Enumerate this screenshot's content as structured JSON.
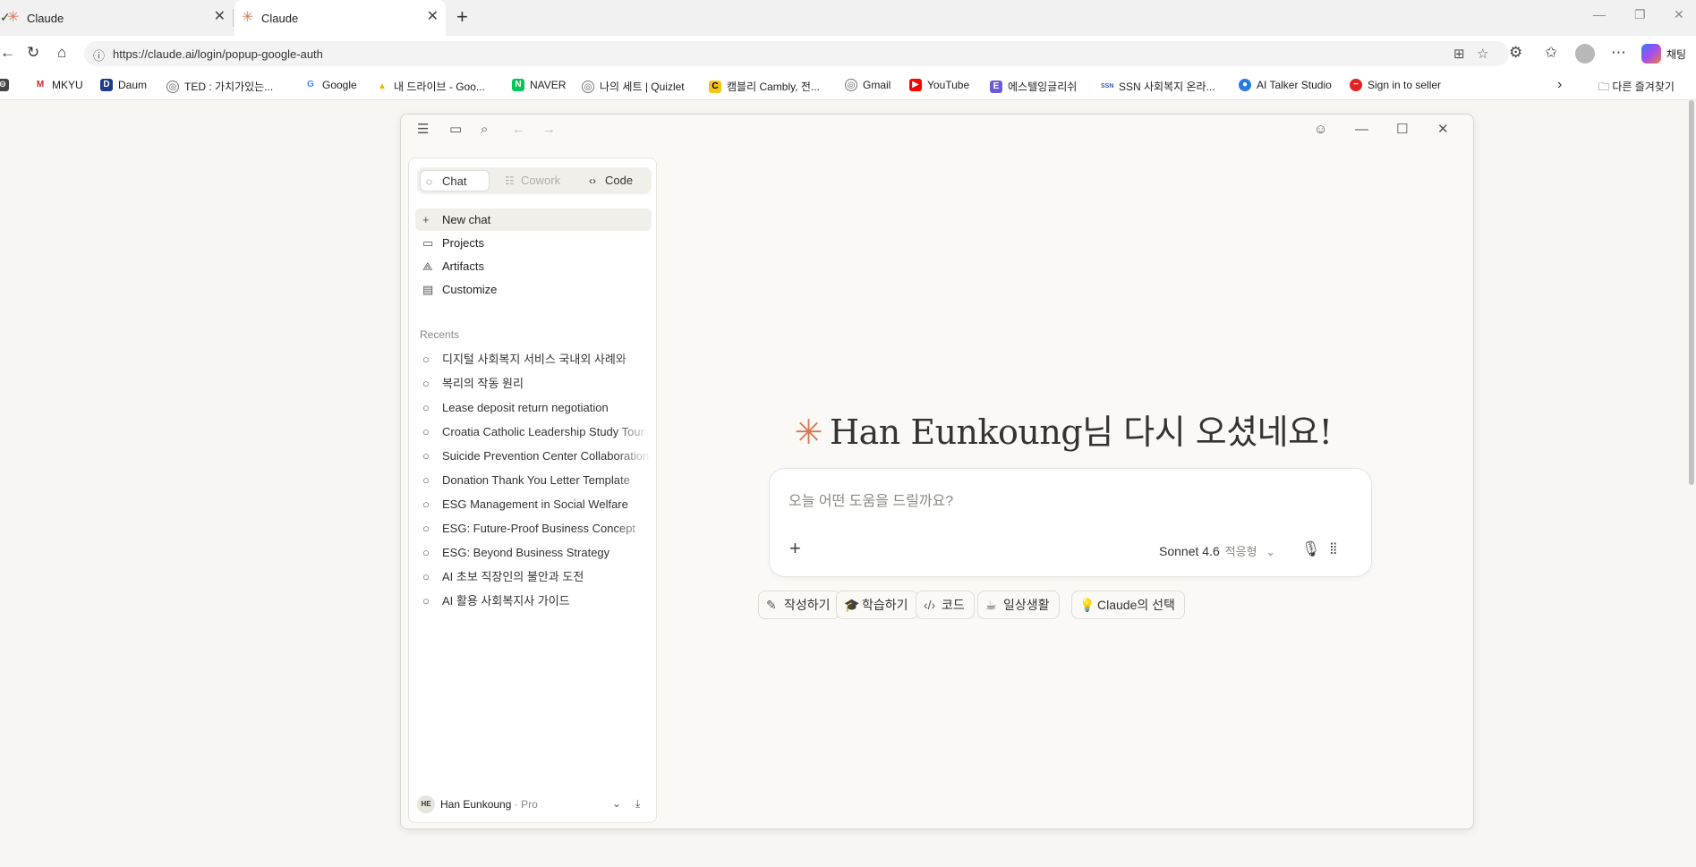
{
  "browser": {
    "tabs": [
      {
        "title": "Claude",
        "close": "✕"
      },
      {
        "title": "Claude",
        "close": "✕"
      }
    ],
    "new_tab": "+",
    "url": "https://claude.ai/login/popup-google-auth",
    "profile_label": "채팅",
    "bookmarks": [
      {
        "label": "MKYU",
        "icon": "mkyu-icon",
        "color": "#d11f2a"
      },
      {
        "label": "Daum",
        "icon": "daum-icon",
        "color": "#1e3a8a"
      },
      {
        "label": "TED : 가치가있는...",
        "icon": "globe-icon",
        "color": "#555555"
      },
      {
        "label": "Google",
        "icon": "google-icon",
        "color": "#4285f4"
      },
      {
        "label": "내 드라이브 - Goo...",
        "icon": "drive-icon",
        "color": "#f4b400"
      },
      {
        "label": "NAVER",
        "icon": "naver-icon",
        "color": "#03c75a"
      },
      {
        "label": "나의 세트 | Quizlet",
        "icon": "globe-icon",
        "color": "#555555"
      },
      {
        "label": "캠블리 Cambly, 전...",
        "icon": "cambly-icon",
        "color": "#f5c518"
      },
      {
        "label": "Gmail",
        "icon": "globe-icon",
        "color": "#555555"
      },
      {
        "label": "YouTube",
        "icon": "youtube-icon",
        "color": "#ff0000"
      },
      {
        "label": "에스텔잉글리쉬",
        "icon": "estel-icon",
        "color": "#6b5bd6"
      },
      {
        "label": "SSN 사회복지 온라...",
        "icon": "ssn-icon",
        "color": "#2a5db0"
      },
      {
        "label": "AI Talker Studio",
        "icon": "aitalker-icon",
        "color": "#2a7be0"
      },
      {
        "label": "Sign in to seller",
        "icon": "seller-icon",
        "color": "#e02424"
      }
    ],
    "other_bookmarks": "다른 즐겨찾기"
  },
  "app": {
    "modes": [
      {
        "label": "Chat",
        "state": "active"
      },
      {
        "label": "Cowork",
        "state": "disabled"
      },
      {
        "label": "Code",
        "state": "normal"
      }
    ],
    "nav": [
      {
        "label": "New chat",
        "icon": "plus-icon"
      },
      {
        "label": "Projects",
        "icon": "folder-icon"
      },
      {
        "label": "Artifacts",
        "icon": "shapes-icon"
      },
      {
        "label": "Customize",
        "icon": "briefcase-icon"
      }
    ],
    "recents_label": "Recents",
    "recents": [
      "디지털 사회복지 서비스 국내외 사례와 ",
      "복리의 작동 원리",
      "Lease deposit return negotiation",
      "Croatia Catholic Leadership Study Tour",
      "Suicide Prevention Center Collaboration",
      "Donation Thank You Letter Template",
      "ESG Management in Social Welfare",
      "ESG: Future-Proof Business Concept",
      "ESG: Beyond Business Strategy",
      "AI 초보 직장인의 불안과 도전",
      "AI 활용 사회복지사 가이드"
    ],
    "user": {
      "initials": "HE",
      "name": "Han Eunkoung",
      "plan": " · Pro"
    },
    "greeting": "Han Eunkoung님 다시 오셨네요!",
    "composer": {
      "placeholder": "오늘 어떤 도움을 드릴까요?",
      "model": "Sonnet 4.6",
      "mode": "적응형"
    },
    "chips": [
      "작성하기",
      "학습하기",
      "코드",
      "일상생활",
      "Claude의 선택"
    ],
    "accent": "#d97757"
  }
}
